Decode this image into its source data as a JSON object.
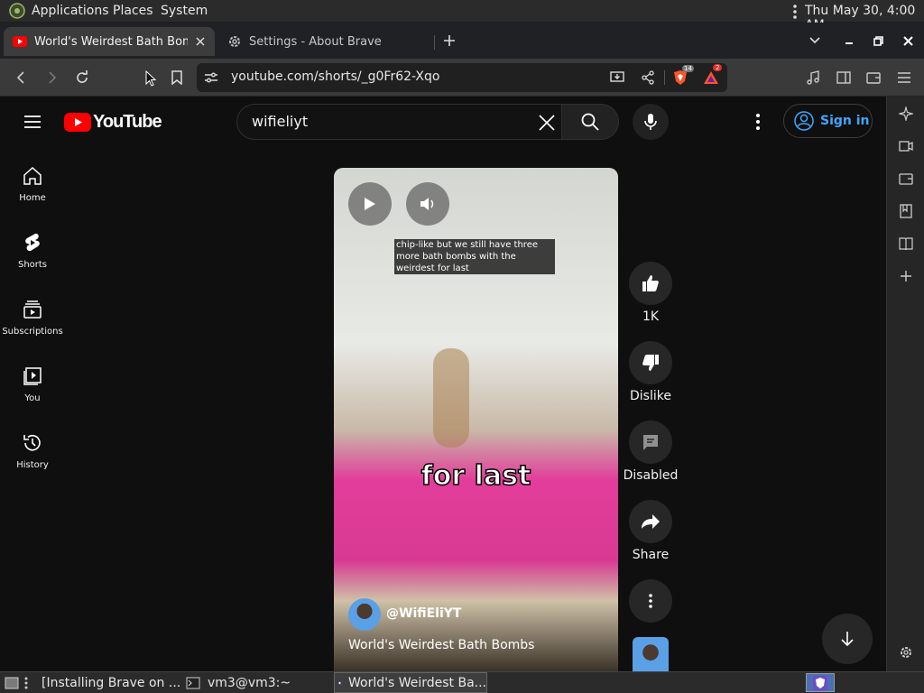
{
  "panel": {
    "applications": "Applications",
    "places": "Places",
    "system": "System",
    "clock": "Thu May 30,  4:00 AM"
  },
  "tabs": [
    {
      "title": "World's Weirdest Bath Bomb",
      "active": true
    },
    {
      "title": "Settings - About Brave",
      "active": false
    }
  ],
  "address": {
    "url": "youtube.com/shorts/_g0Fr62-Xqo",
    "shields_count": "14",
    "rewards_count": "2"
  },
  "youtube": {
    "logo_text": "YouTube",
    "search_value": "wifieliyt",
    "sign_in": "Sign in",
    "guide": [
      "Home",
      "Shorts",
      "Subscriptions",
      "You",
      "History"
    ],
    "caption_small": "chip-like but we still have three more bath bombs with the weirdest for last",
    "caption_big": "for last",
    "channel": "@WifiEliYT",
    "video_title": "World's Weirdest Bath Bombs",
    "actions": {
      "like_count": "1K",
      "dislike": "Dislike",
      "comments": "Disabled",
      "share": "Share"
    }
  },
  "taskbar": {
    "items": [
      "[Installing Brave on ...",
      "vm3@vm3:~",
      "World's Weirdest Ba..."
    ]
  },
  "colors": {
    "accent_blue": "#3ea6ff",
    "youtube_red": "#ff0000",
    "brave_orange": "#fb542b"
  }
}
